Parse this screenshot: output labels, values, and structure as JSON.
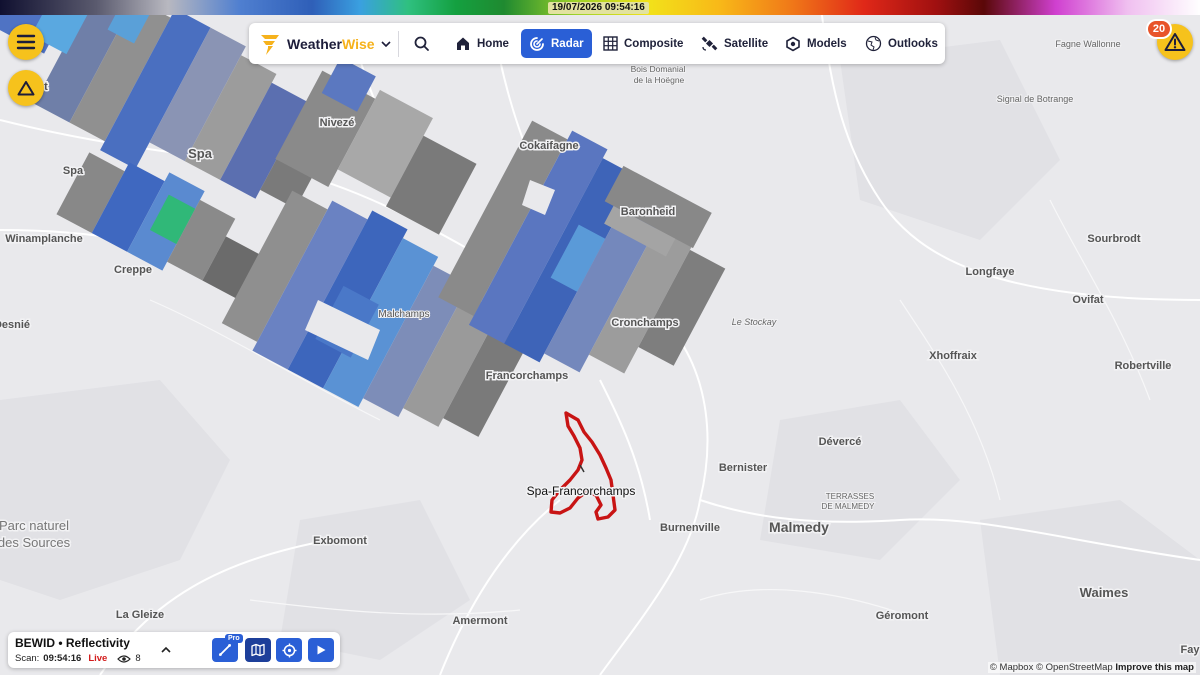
{
  "top_bar": {
    "timestamp": "19/07/2026 09:54:16"
  },
  "nav": {
    "brand_weather": "Weather",
    "brand_wise": "Wise",
    "items": [
      {
        "label": "Home",
        "icon": "home-icon"
      },
      {
        "label": "Radar",
        "icon": "radar-icon",
        "active": true
      },
      {
        "label": "Composite",
        "icon": "grid-icon"
      },
      {
        "label": "Satellite",
        "icon": "satellite-icon"
      },
      {
        "label": "Models",
        "icon": "models-icon"
      },
      {
        "label": "Outlooks",
        "icon": "globe-icon"
      }
    ]
  },
  "alerts": {
    "count": "20"
  },
  "map_labels": {
    "fagne": "Fagne Wallonne",
    "bois_domanial": "Bois Domanial",
    "hoegne": "de la Hoëgne",
    "signal_botrange": "Signal de Botrange",
    "spa_upper": "Spa",
    "spa_left": "Spa",
    "niveze": "Nivezé",
    "cokaifagne": "Cokaifagne",
    "baronheid": "Baronheid",
    "winamplanche": "Winamplanche",
    "creppe": "Creppe",
    "sourbrodt": "Sourbrodt",
    "longfaye": "Longfaye",
    "ovifat": "Ovifat",
    "malchamps": "Malchamps",
    "cronchamps": "Cronchamps",
    "le_stockay": "Le Stockay",
    "desnie": "Desnié",
    "xhoffraix": "Xhoffraix",
    "robertville": "Robertville",
    "francorchamps": "Francorchamps",
    "deverce": "Dévercé",
    "bernister": "Bernister",
    "spa_francorchamps": "Spa-Francorchamps",
    "terrasses": "TERRASSES",
    "de_malmedy": "DE MALMEDY",
    "parc_naturel": "Parc naturel",
    "des_sources": "des Sources",
    "exbomont": "Exbomont",
    "burnenville": "Burnenville",
    "malmedy": "Malmedy",
    "la_gleize": "La Gleize",
    "amermont": "Amermont",
    "geromont": "Géromont",
    "waimes": "Waimes",
    "fay": "Fay",
    "edge_t": "t"
  },
  "attribution": {
    "mapbox": "© Mapbox",
    "osm": "© OpenStreetMap",
    "improve": "Improve this map"
  },
  "panel": {
    "title": "BEWID • Reflectivity",
    "scan_label": "Scan:",
    "scan_time": "09:54:16",
    "live": "Live",
    "viewers": "8",
    "pro": "Pro"
  },
  "colors": {
    "accent": "#2a5fd6",
    "warning": "#f6c21c",
    "circuit": "#c81414"
  }
}
